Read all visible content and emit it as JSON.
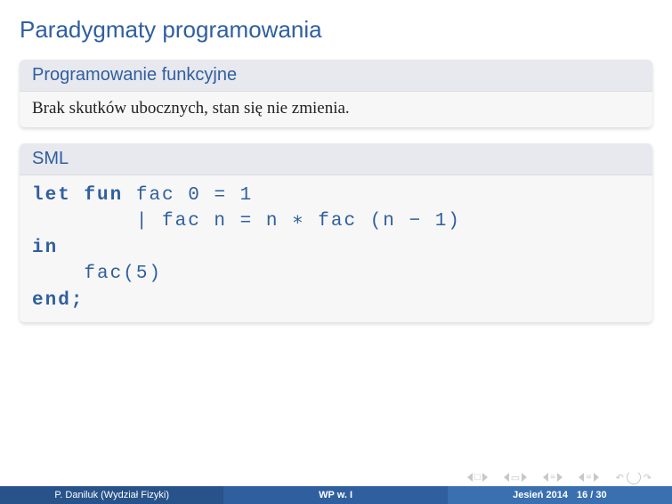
{
  "title": "Paradygmaty programowania",
  "block1": {
    "title": "Programowanie funkcyjne",
    "body": "Brak skutków ubocznych, stan się nie zmienia."
  },
  "block2": {
    "title": "SML",
    "code": {
      "l1a": "let ",
      "l1b": "fun",
      "l1c": " fac 0 = 1",
      "l2": "        | fac n = n ∗ fac (n − 1)",
      "l3": "in",
      "l4": "    fac(5)",
      "l5": "end;"
    }
  },
  "footer": {
    "author": "P. Daniluk (Wydział Fizyki)",
    "course": "WP w. I",
    "term": "Jesień 2014",
    "page": "16 / 30"
  },
  "nav": {
    "first": "first-icon",
    "prev": "prev-icon",
    "prevsec": "prev-section-icon",
    "nextsec": "next-section-icon",
    "next": "next-icon",
    "last": "last-icon",
    "loop": "loop-icon"
  }
}
